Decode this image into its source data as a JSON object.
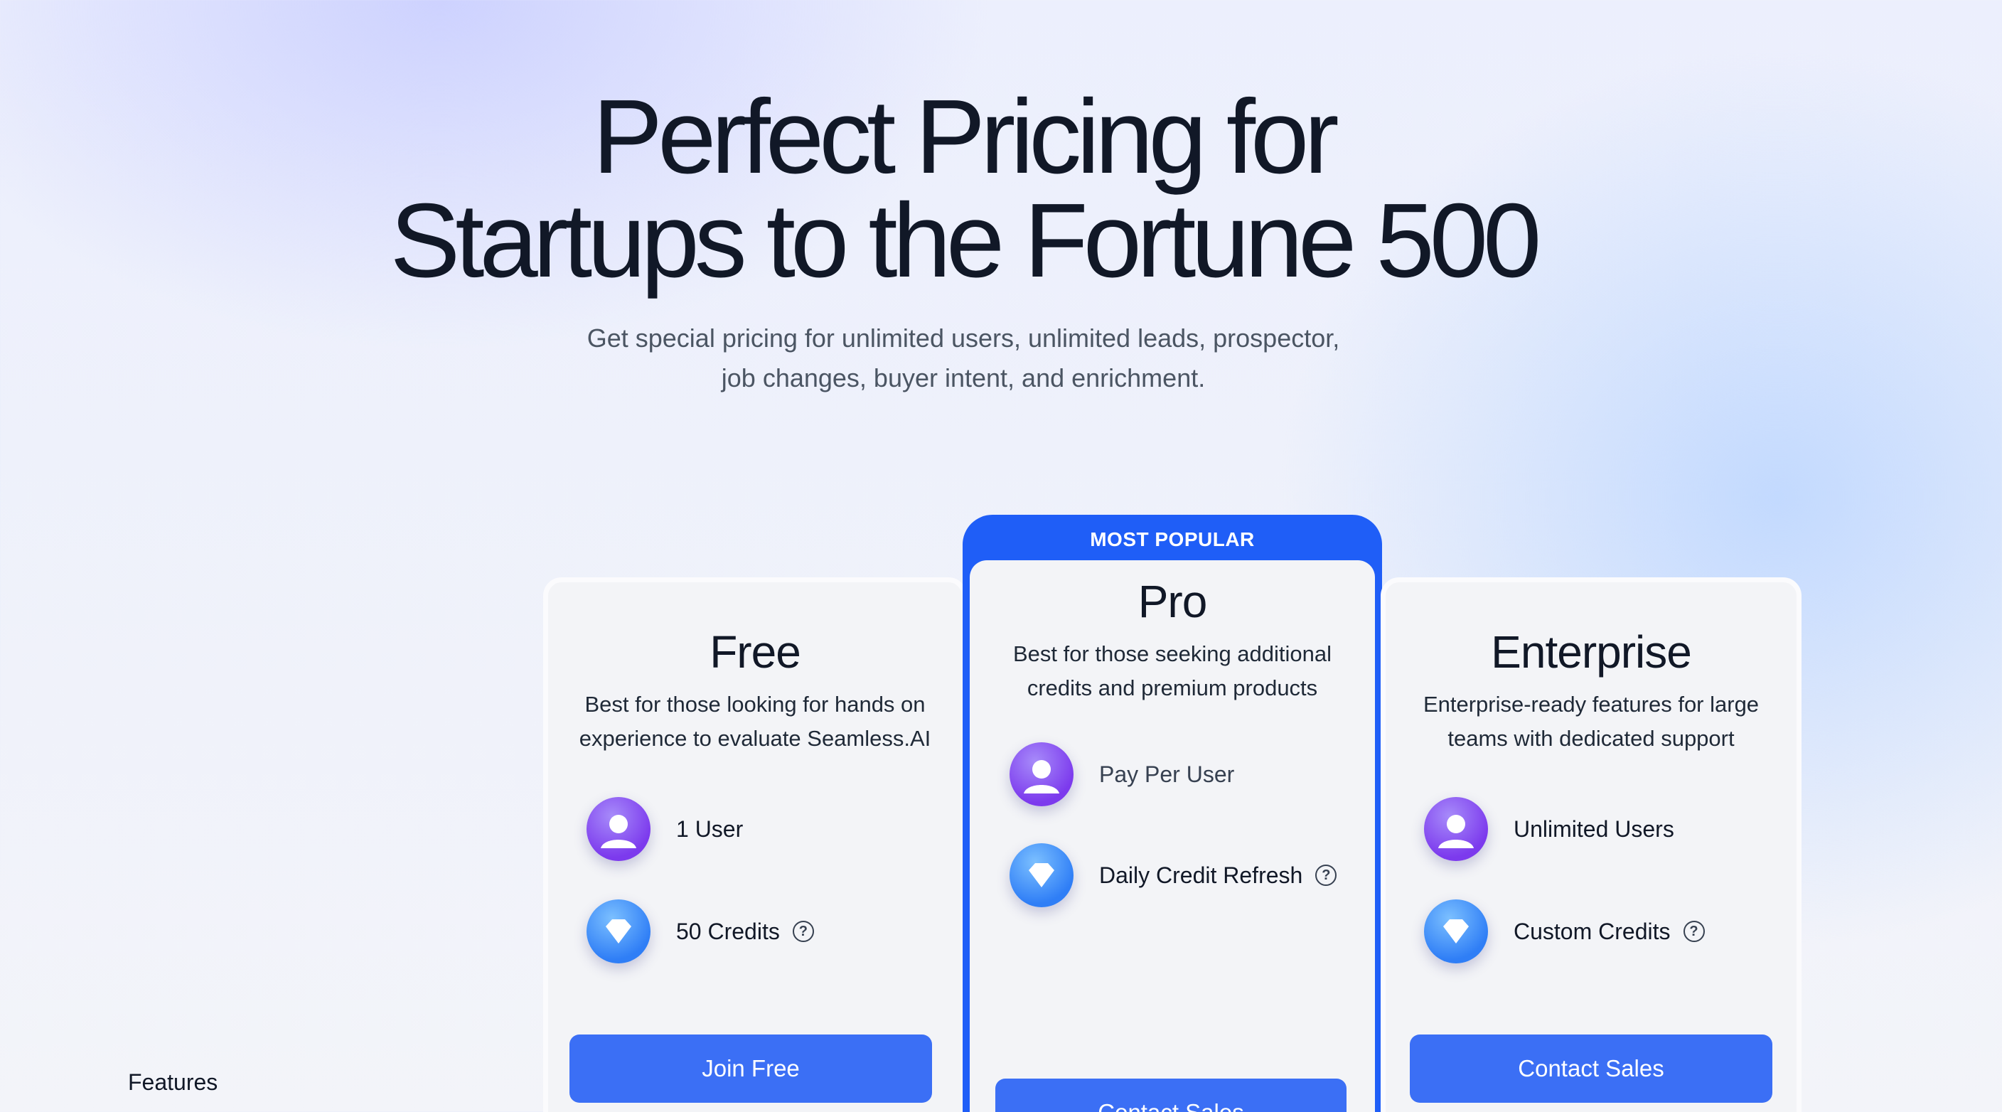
{
  "hero": {
    "title_line1": "Perfect Pricing for",
    "title_line2": "Startups to the Fortune 500",
    "subtitle_line1": "Get special pricing for unlimited users, unlimited leads, prospector,",
    "subtitle_line2": "job changes, buyer intent, and enrichment."
  },
  "plans": {
    "free": {
      "name": "Free",
      "desc_line1": "Best for those looking for hands on",
      "desc_line2": "experience to evaluate Seamless.AI",
      "users": "1 User",
      "credits": "50 Credits",
      "cta": "Join Free"
    },
    "pro": {
      "badge": "MOST POPULAR",
      "name": "Pro",
      "desc_line1": "Best for those seeking additional",
      "desc_line2": "credits and premium products",
      "users": "Pay Per User",
      "credits": "Daily Credit Refresh",
      "cta": "Contact Sales"
    },
    "enterprise": {
      "name": "Enterprise",
      "desc_line1": "Enterprise-ready features for large",
      "desc_line2": "teams with dedicated support",
      "users": "Unlimited Users",
      "credits": "Custom Credits",
      "cta": "Contact Sales"
    }
  },
  "footer": {
    "features_label": "Features"
  },
  "icons": {
    "user": "user-avatar-icon",
    "credit": "diamond-icon",
    "help": "help-circle-icon"
  },
  "colors": {
    "accent": "#1f5ef7",
    "button": "#3b6ff5",
    "user_icon": "#7c3aed",
    "credit_icon": "#2f7ef6"
  }
}
